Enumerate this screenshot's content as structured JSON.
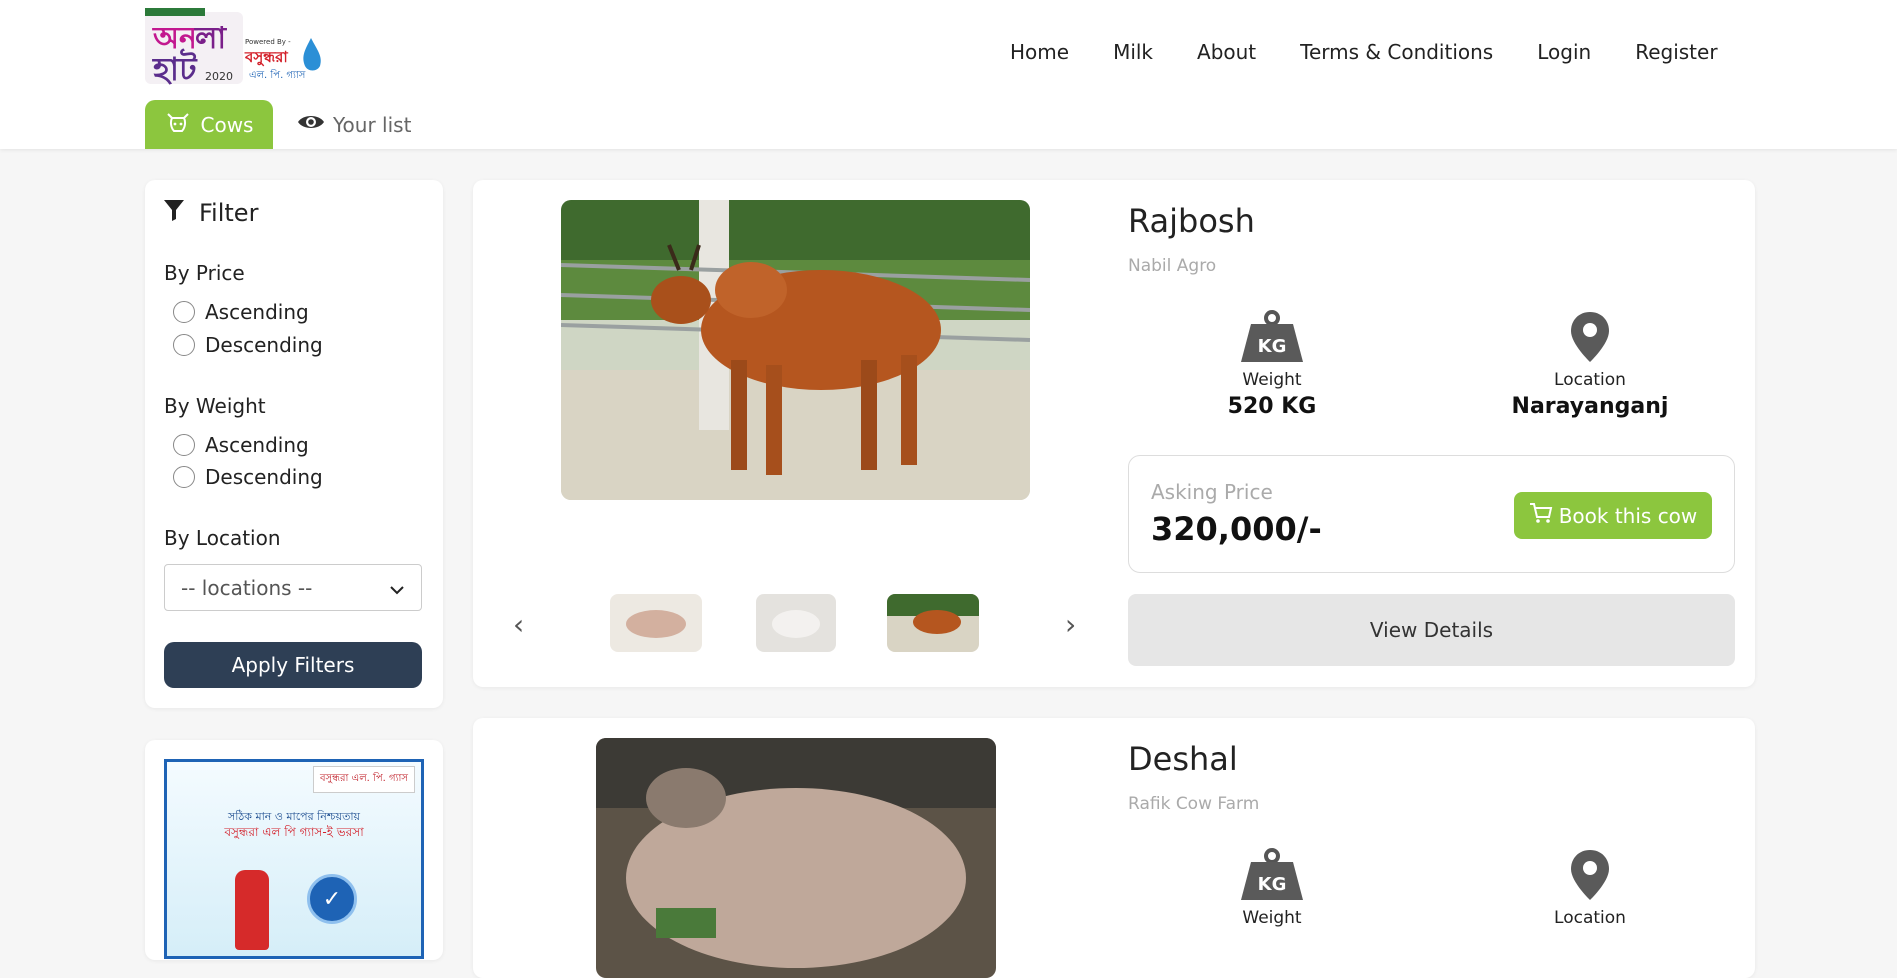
{
  "header": {
    "logo_text": "অনলাইন হাট 2020",
    "logo_powered": "Powered By -",
    "logo_brand": "বসুন্ধরা এল. পি. গ্যাস",
    "nav": [
      "Home",
      "Milk",
      "About",
      "Terms & Conditions",
      "Login",
      "Register"
    ]
  },
  "tabs": [
    {
      "label": "Cows",
      "icon": "cow-icon",
      "active": true
    },
    {
      "label": "Your list",
      "icon": "eye-icon",
      "active": false
    }
  ],
  "filter": {
    "title": "Filter",
    "by_price": {
      "label": "By Price",
      "options": [
        "Ascending",
        "Descending"
      ]
    },
    "by_weight": {
      "label": "By Weight",
      "options": [
        "Ascending",
        "Descending"
      ]
    },
    "by_location": {
      "label": "By Location",
      "selected": "-- locations --"
    },
    "apply_label": "Apply Filters"
  },
  "ad": {
    "logo": "বসুন্ধরা এল. পি. গ্যাস",
    "line1": "সঠিক মান ও মাপের নিশ্চয়তায়",
    "line2": "বসুন্ধরা এল পি গ্যাস-ই ভরসা"
  },
  "listings": [
    {
      "name": "Rajbosh",
      "farm": "Nabil Agro",
      "weight_label": "Weight",
      "weight": "520 KG",
      "location_label": "Location",
      "location": "Narayanganj",
      "price_label": "Asking Price",
      "price": "320,000/-",
      "book_label": "Book this cow",
      "details_label": "View Details",
      "kg_icon_text": "KG"
    },
    {
      "name": "Deshal",
      "farm": "Rafik Cow Farm",
      "weight_label": "Weight",
      "location_label": "Location",
      "kg_icon_text": "KG"
    }
  ],
  "colors": {
    "accent": "#8cc63e",
    "dark_button": "#2e3f55",
    "background": "#f6f6f6"
  }
}
